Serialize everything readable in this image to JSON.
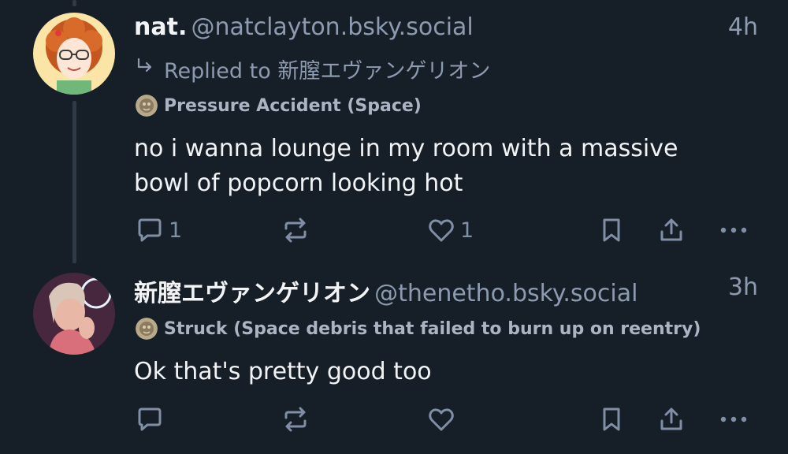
{
  "posts": [
    {
      "display_name": "nat.",
      "handle": "@natclayton.bsky.social",
      "time": "4h",
      "reply_prefix": "Replied to",
      "reply_to": "新膣エヴァンゲリオン",
      "label": "Pressure Accident (Space)",
      "text": "no i wanna lounge in my room with a massive bowl of popcorn looking hot",
      "reply_count": "1",
      "repost_count": "",
      "like_count": "1"
    },
    {
      "display_name": "新膣エヴァンゲリオン",
      "handle": "@thenetho.bsky.social",
      "time": "3h",
      "label": "Struck (Space debris that failed to burn up on reentry)",
      "text": "Ok that's pretty good too",
      "reply_count": "",
      "repost_count": "",
      "like_count": ""
    }
  ],
  "icons": {
    "reply": "speech-bubble-icon",
    "repost": "repost-arrows-icon",
    "like": "heart-icon",
    "bookmark": "bookmark-icon",
    "share": "share-upload-icon",
    "more": "more-dots-icon"
  },
  "colors": {
    "background": "#161e27",
    "text": "#f1f3f5",
    "muted": "#8d9bb0",
    "icon": "#7f8fa6"
  }
}
